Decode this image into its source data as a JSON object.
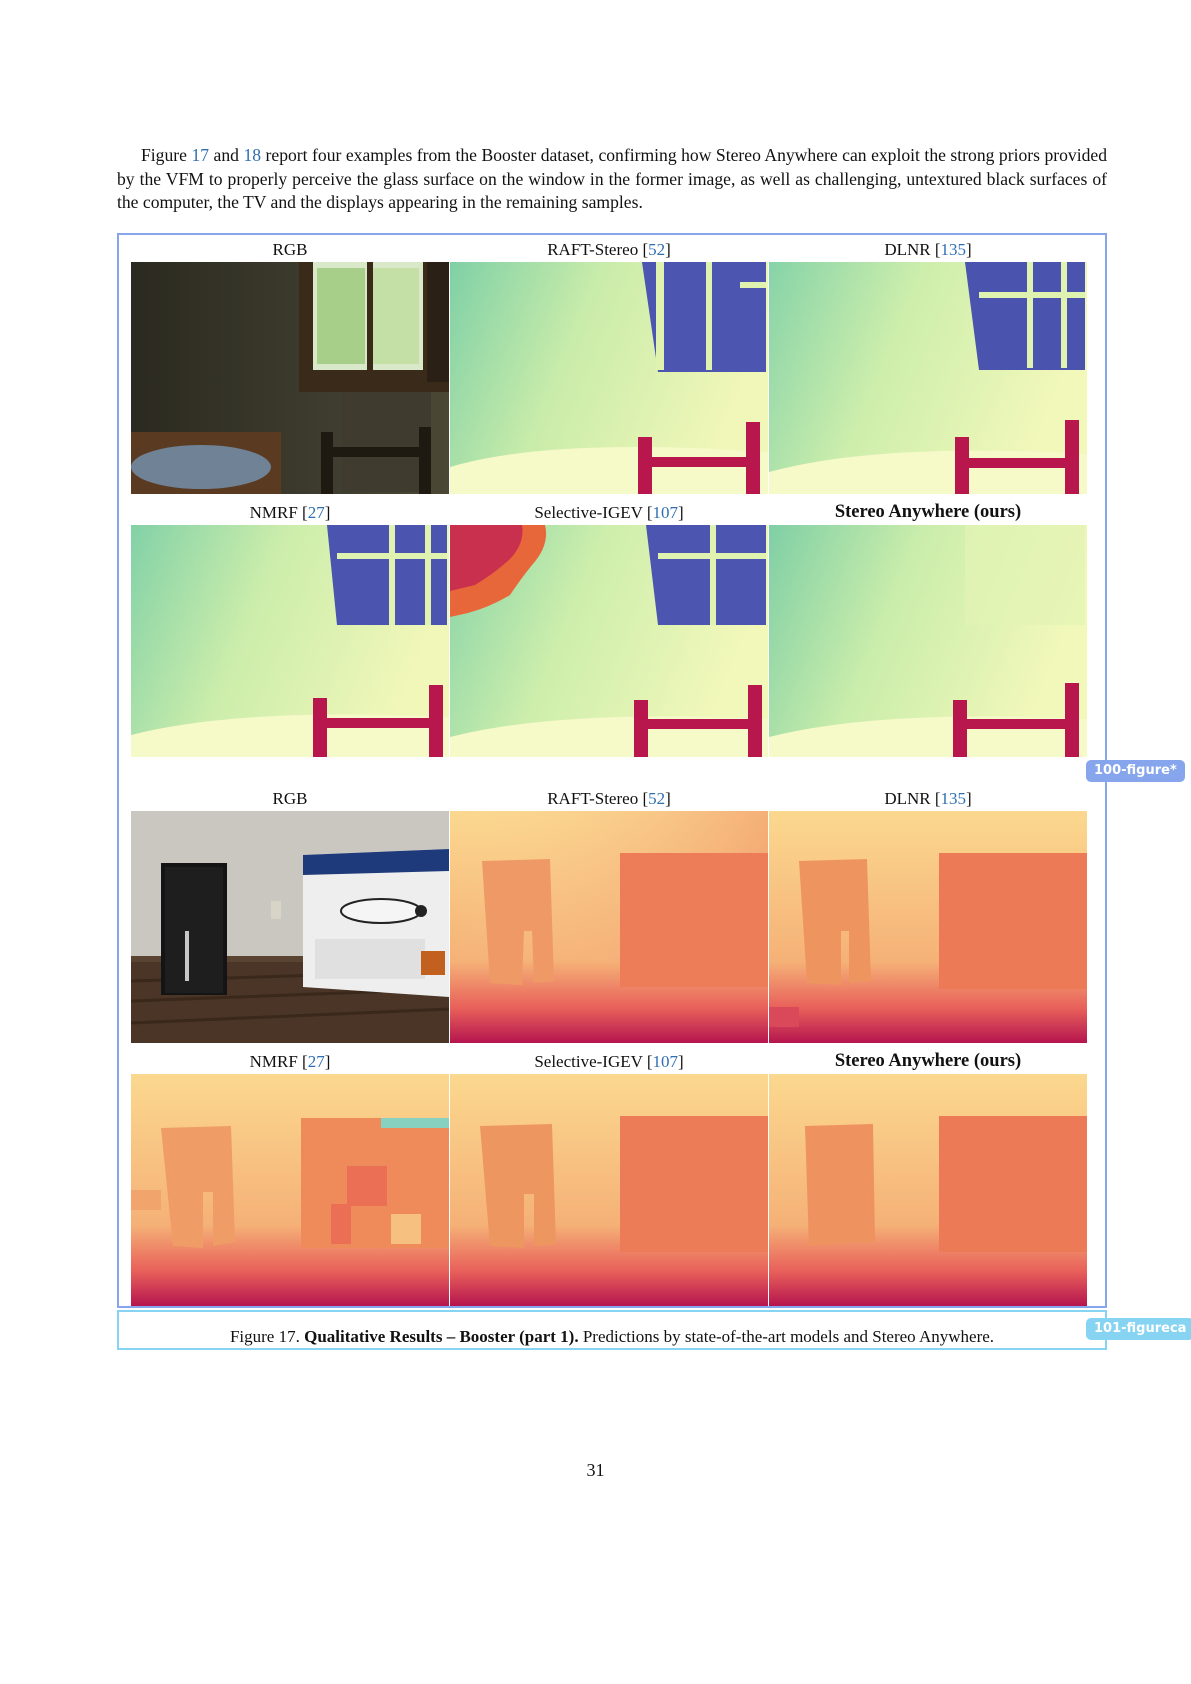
{
  "intro": {
    "t1": "Figure ",
    "ref1": "17",
    "t2": " and ",
    "ref2": "18",
    "t3": " report four examples from the Booster dataset, confirming how Stereo Anywhere can exploit the strong priors provided by the VFM to properly perceive the glass surface on the window in the former image, as well as challenging, untextured black surfaces of the computer, the TV and the displays appearing in the remaining samples."
  },
  "labels": {
    "rgb": "RGB",
    "raft": "RAFT-Stereo [",
    "raft_ref": "52",
    "dlnr": "DLNR [",
    "dlnr_ref": "135",
    "nmrf": "NMRF [",
    "nmrf_ref": "27",
    "sigev": "Selective-IGEV [",
    "sigev_ref": "107",
    "close": "]",
    "ours": "Stereo Anywhere (ours)"
  },
  "tags": {
    "figure": "100-figure*",
    "caption": "101-figureca"
  },
  "caption": {
    "prefix": "Figure 17. ",
    "bold": "Qualitative Results – Booster (part 1).",
    "rest": " Predictions by state-of-the-art models and Stereo Anywhere."
  },
  "page_number": "31"
}
